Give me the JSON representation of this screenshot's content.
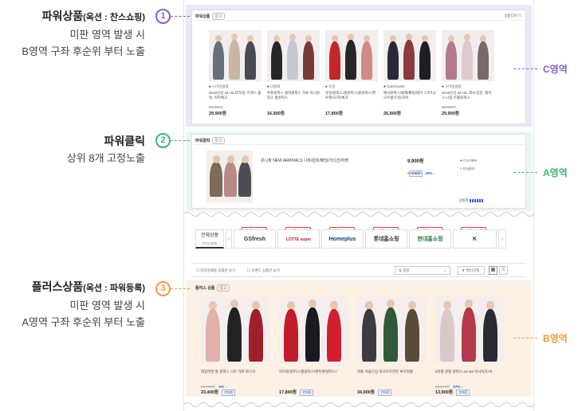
{
  "annotations": [
    {
      "num": "1",
      "title": "파워상품",
      "title_sub": "(옥션 : 찬스쇼핑)",
      "lines": [
        "미판 영역 발생 시",
        "B영역 구좌 후순위 부터 노출"
      ],
      "color": "#8b5cc6"
    },
    {
      "num": "2",
      "title": "파워클릭",
      "title_sub": "",
      "lines": [
        "상위 8개 고정노출"
      ],
      "color": "#3fb37a"
    },
    {
      "num": "3",
      "title": "플러스상품",
      "title_sub": "(옥션 : 파워등록)",
      "lines": [
        "미판 영역 발생 시",
        "A영역 구좌 후순위 부터 노출"
      ],
      "color": "#f09a3e"
    }
  ],
  "zone_labels": {
    "c": "C영역",
    "a": "A영역",
    "b": "B영역"
  },
  "colors": {
    "c": "#8b5cc6",
    "a": "#3fb37a",
    "b": "#f09a3e"
  },
  "power_products": {
    "title": "파워상품",
    "tag": "알고",
    "link": "상품더보기",
    "items": [
      {
        "seller": "스마일클럽",
        "desc": "2018신상 44~XL다하게, 트렌스 울룩, 지퍼체크",
        "orig": "35,800원",
        "price": "29,900원"
      },
      {
        "seller": "나빌레",
        "desc": "투톤원피스 롱라원피스 가로 이니원피스 롱원피스",
        "orig": "",
        "price": "16,900원"
      },
      {
        "seller": "유일",
        "desc": "유일/원피스/롱원피스/롱원피스/맨투맨/오/자/체크",
        "orig": "",
        "price": "17,800원"
      },
      {
        "seller": "Gatshow94",
        "desc": "예사원피스/롱팩/롤링/데이 스/터니/오트롱/드타/코이",
        "orig": "",
        "price": "26,800원"
      },
      {
        "seller": "스마일클럽",
        "desc": "2018신상 44~XL 래셔,장문, 래이스 나잠,트롤원피스",
        "orig": "35,800원",
        "price": "29,900원"
      }
    ]
  },
  "power_click": {
    "title": "파워클릭",
    "tag": "알고",
    "product": "유니파 NEW ARRIVALS 니트/원트/패딩/가디건/자켓",
    "price": "9,900원",
    "orig": "13,900원",
    "discount": "29% ↓",
    "button": "판매중",
    "seller": "Cut 88%",
    "seller2": "English",
    "rating_label": "상품평"
  },
  "shop_tabs": {
    "first_label": "전체상품",
    "first_sub": "(703,289)",
    "items": [
      {
        "badge": "7만~10%",
        "name": "GSfresh"
      },
      {
        "badge": "7만~10%",
        "name": "LOTTE super"
      },
      {
        "badge": "7만~10%",
        "name": "Homeplus"
      },
      {
        "badge": "7만~10%",
        "name": "롯데홈쇼핑"
      },
      {
        "badge": "7만~10%",
        "name": "현대홈쇼핑"
      },
      {
        "badge": "7만~10%",
        "name": "K"
      }
    ]
  },
  "filters": {
    "check1": "리미일배송 상품만 보기",
    "check2": "브랜드 상품만 보기",
    "sort": "정렬",
    "filter": "필터선택"
  },
  "plus_products": {
    "title": "플러스 상품",
    "tag": "알고",
    "items": [
      {
        "desc": "데일리면 롱 원피스 니트 가로 박스티",
        "orig": "25,900원",
        "discount": "6% ↓",
        "price": "23,400원",
        "button": "판매중"
      },
      {
        "desc": "하이원/원피스/롱원피스/맨투맨/원피스/",
        "orig": "",
        "discount": "",
        "price": "17,800원",
        "button": "판매중"
      },
      {
        "desc": "자홍 겨울신상 빅사이즈전문 루즈핏롱",
        "orig": "",
        "discount": "",
        "price": "34,900원",
        "button": "판매중"
      },
      {
        "desc": "5차롱 같향 원피스 44~88 빅사이즈/셔",
        "orig": "20,800원",
        "discount": "57% ↓",
        "price": "13,900원",
        "button": "판매중"
      }
    ]
  }
}
